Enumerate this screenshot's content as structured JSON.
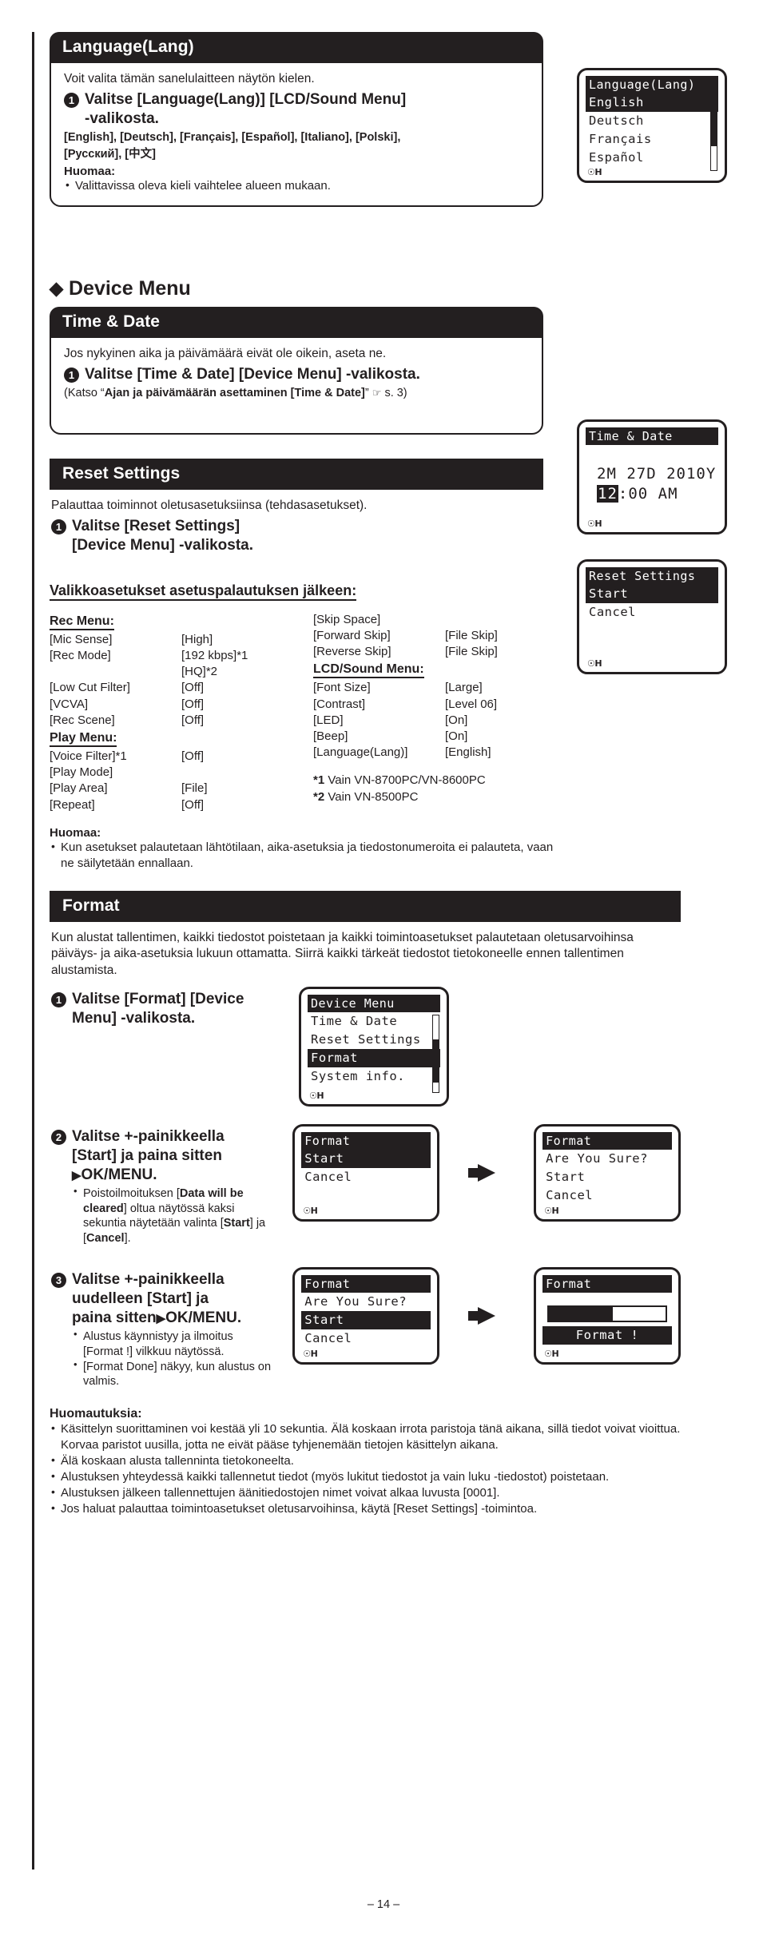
{
  "page": {
    "number": "– 14 –"
  },
  "language_section": {
    "title": "Language(Lang)",
    "intro": "Voit valita tämän sanelulaitteen näytön kielen.",
    "step1_num": "1",
    "step1_line1": "Valitse [Language(Lang)] [LCD/Sound Menu]",
    "step1_line2": "-valikosta.",
    "options_line1": "[English], [Deutsch], [Français], [Español], [Italiano], [Polski],",
    "options_line2": "[Русский], [中文]",
    "note_head": "Huomaa:",
    "notes": [
      "Valittavissa oleva kieli vaihtelee alueen mukaan."
    ],
    "lcd": {
      "title": "Language(Lang)",
      "rows": [
        "English",
        "Deutsch",
        "Français",
        "Español"
      ],
      "selected_index": 0,
      "mic": "H"
    }
  },
  "device_menu": {
    "heading": "Device Menu",
    "time_date": {
      "title": "Time & Date",
      "intro": "Jos nykyinen aika ja päivämäärä eivät ole oikein, aseta ne.",
      "step1_num": "1",
      "step1": "Valitse [Time & Date] [Device Menu] -valikosta.",
      "ref_pre": "(Katso “",
      "ref_bold": "Ajan ja päivämäärän asettaminen [Time & Date]",
      "ref_post": "”",
      "ref_page": "s. 3)",
      "lcd": {
        "title": "Time & Date",
        "date": "2M 27D 2010Y",
        "time_sel": "12",
        "time_rest": ":00 AM",
        "mic": "H"
      }
    },
    "reset_settings": {
      "title": "Reset Settings",
      "intro": "Palauttaa toiminnot oletusasetuksiinsa (tehdasasetukset).",
      "step1_num": "1",
      "step1_line1": "Valitse [Reset Settings]",
      "step1_line2": "[Device Menu] -valikosta.",
      "table_heading": "Valikkoasetukset asetuspalautuksen jälkeen:",
      "lcd": {
        "title": "Reset Settings",
        "rows": [
          "Start",
          "Cancel"
        ],
        "selected_index": 0,
        "mic": "H"
      },
      "groups_left": [
        {
          "name": "Rec Menu:",
          "rows": [
            {
              "key": "[Mic Sense]",
              "value": "[High]",
              "indent": 0
            },
            {
              "key": "[Rec Mode]",
              "value": "[192 kbps]*1",
              "indent": 0
            },
            {
              "key": "",
              "value": "[HQ]*2",
              "indent": 0
            },
            {
              "key": "[Low Cut Filter]",
              "value": "[Off]",
              "indent": 0
            },
            {
              "key": "[VCVA]",
              "value": "[Off]",
              "indent": 0
            },
            {
              "key": "[Rec Scene]",
              "value": "[Off]",
              "indent": 0
            }
          ]
        },
        {
          "name": "Play Menu:",
          "rows": [
            {
              "key": "[Voice Filter]*1",
              "value": "[Off]",
              "indent": 0
            },
            {
              "key": "[Play Mode]",
              "value": "",
              "indent": 0
            },
            {
              "key": "[Play Area]",
              "value": "[File]",
              "indent": 1
            },
            {
              "key": "[Repeat]",
              "value": "[Off]",
              "indent": 1
            }
          ]
        }
      ],
      "groups_right": [
        {
          "name": "",
          "rows": [
            {
              "key": "[Skip Space]",
              "value": "",
              "indent": 0
            },
            {
              "key": "[Forward Skip]",
              "value": "[File Skip]",
              "indent": 1
            },
            {
              "key": "[Reverse Skip]",
              "value": "[File Skip]",
              "indent": 1
            }
          ]
        },
        {
          "name": "LCD/Sound Menu:",
          "rows": [
            {
              "key": "[Font Size]",
              "value": "[Large]",
              "indent": 0
            },
            {
              "key": "[Contrast]",
              "value": "[Level 06]",
              "indent": 0
            },
            {
              "key": "[LED]",
              "value": "[On]",
              "indent": 0
            },
            {
              "key": "[Beep]",
              "value": "[On]",
              "indent": 0
            },
            {
              "key": "[Language(Lang)]",
              "value": "[English]",
              "indent": 0
            }
          ]
        }
      ],
      "footnote1_mark": "*1",
      "footnote1_text": "Vain VN-8700PC/VN-8600PC",
      "footnote2_mark": "*2",
      "footnote2_text": "Vain VN-8500PC",
      "note_head": "Huomaa:",
      "notes": [
        "Kun asetukset palautetaan lähtötilaan, aika-asetuksia ja tiedostonumeroita ei palauteta, vaan ne säilytetään ennallaan."
      ]
    }
  },
  "format_section": {
    "title": "Format",
    "intro": "Kun alustat tallentimen, kaikki tiedostot poistetaan ja kaikki toimintoasetukset palautetaan oletusarvoihinsa päiväys- ja aika-asetuksia lukuun ottamatta. Siirrä kaikki tärkeät tiedostot tietokoneelle ennen tallentimen alustamista.",
    "step1_num": "1",
    "step1_line1": "Valitse [Format] [Device",
    "step1_line2": "Menu] -valikosta.",
    "step1_lcd": {
      "title": "Device Menu",
      "rows": [
        "Time & Date",
        "Reset Settings",
        "Format",
        "System info."
      ],
      "selected_index": 2,
      "mic": "H"
    },
    "step2_num": "2",
    "step2_line1": "Valitse +-painikkeella",
    "step2_line2": "[Start] ja paina sitten",
    "step2_line3": "OK/MENU.",
    "step2_note_parts": [
      "Poistoilmoituksen [",
      "Data will be cleared",
      "] oltua näytössä kaksi sekuntia näytetään valinta [",
      "Start",
      "] ja [",
      "Cancel",
      "]."
    ],
    "step2_lcd_a": {
      "title": "Format",
      "rows": [
        "Start",
        "Cancel"
      ],
      "selected_index": 0,
      "mic": "H"
    },
    "step2_lcd_b": {
      "title": "Format",
      "line": "Are You Sure?",
      "rows": [
        "Start",
        "Cancel"
      ],
      "selected_index": -1,
      "mic": "H"
    },
    "step3_num": "3",
    "step3_line1": "Valitse +-painikkeella",
    "step3_line2": "uudelleen [Start] ja",
    "step3_line3": "paina sitten",
    "step3_ok": "OK/MENU.",
    "step3_notes": [
      "Alustus käynnistyy ja ilmoitus [Format !] vilkkuu näytössä.",
      "[Format Done] näkyy, kun alustus on valmis."
    ],
    "step3_lcd_a": {
      "title": "Format",
      "line": "Are You Sure?",
      "rows": [
        "Start",
        "Cancel"
      ],
      "selected_index": 0,
      "mic": "H"
    },
    "step3_lcd_b": {
      "title": "Format",
      "progress_label": "Format !",
      "mic": "H"
    }
  },
  "bottom_notes": {
    "head": "Huomautuksia:",
    "items": [
      "Käsittelyn suorittaminen voi kestää yli 10 sekuntia. Älä koskaan irrota paristoja tänä aikana, sillä tiedot voivat vioittua. Korvaa paristot uusilla, jotta ne eivät pääse tyhjenemään tietojen käsittelyn aikana.",
      "Älä koskaan alusta tallenninta tietokoneelta.",
      "Alustuksen yhteydessä kaikki tallennetut tiedot (myös lukitut tiedostot ja vain luku -tiedostot) poistetaan.",
      "Alustuksen jälkeen tallennettujen äänitiedostojen nimet voivat alkaa luvusta [0001].",
      "Jos haluat palauttaa toimintoasetukset oletusarvoihinsa, käytä [Reset Settings] -toimintoa."
    ]
  }
}
